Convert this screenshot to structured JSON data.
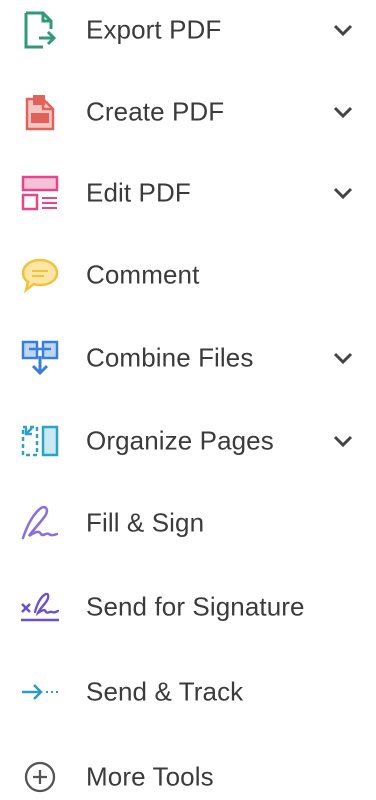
{
  "tools": [
    {
      "label": "Export PDF",
      "icon": "export-pdf-icon",
      "color": "#2e9a7a",
      "expandable": true
    },
    {
      "label": "Create PDF",
      "icon": "create-pdf-icon",
      "color": "#e2625a",
      "expandable": true
    },
    {
      "label": "Edit PDF",
      "icon": "edit-pdf-icon",
      "color": "#e6458a",
      "expandable": true
    },
    {
      "label": "Comment",
      "icon": "comment-icon",
      "color": "#f3c23a",
      "expandable": false
    },
    {
      "label": "Combine Files",
      "icon": "combine-files-icon",
      "color": "#3a7fd6",
      "expandable": true
    },
    {
      "label": "Organize Pages",
      "icon": "organize-pages-icon",
      "color": "#2aa3c6",
      "expandable": true
    },
    {
      "label": "Fill & Sign",
      "icon": "fill-sign-icon",
      "color": "#8a6de0",
      "expandable": false
    },
    {
      "label": "Send for Signature",
      "icon": "send-for-signature-icon",
      "color": "#6a4fd0",
      "expandable": false
    },
    {
      "label": "Send & Track",
      "icon": "send-track-icon",
      "color": "#2a9cc4",
      "expandable": false
    },
    {
      "label": "More Tools",
      "icon": "more-tools-icon",
      "color": "#555555",
      "expandable": false
    }
  ]
}
